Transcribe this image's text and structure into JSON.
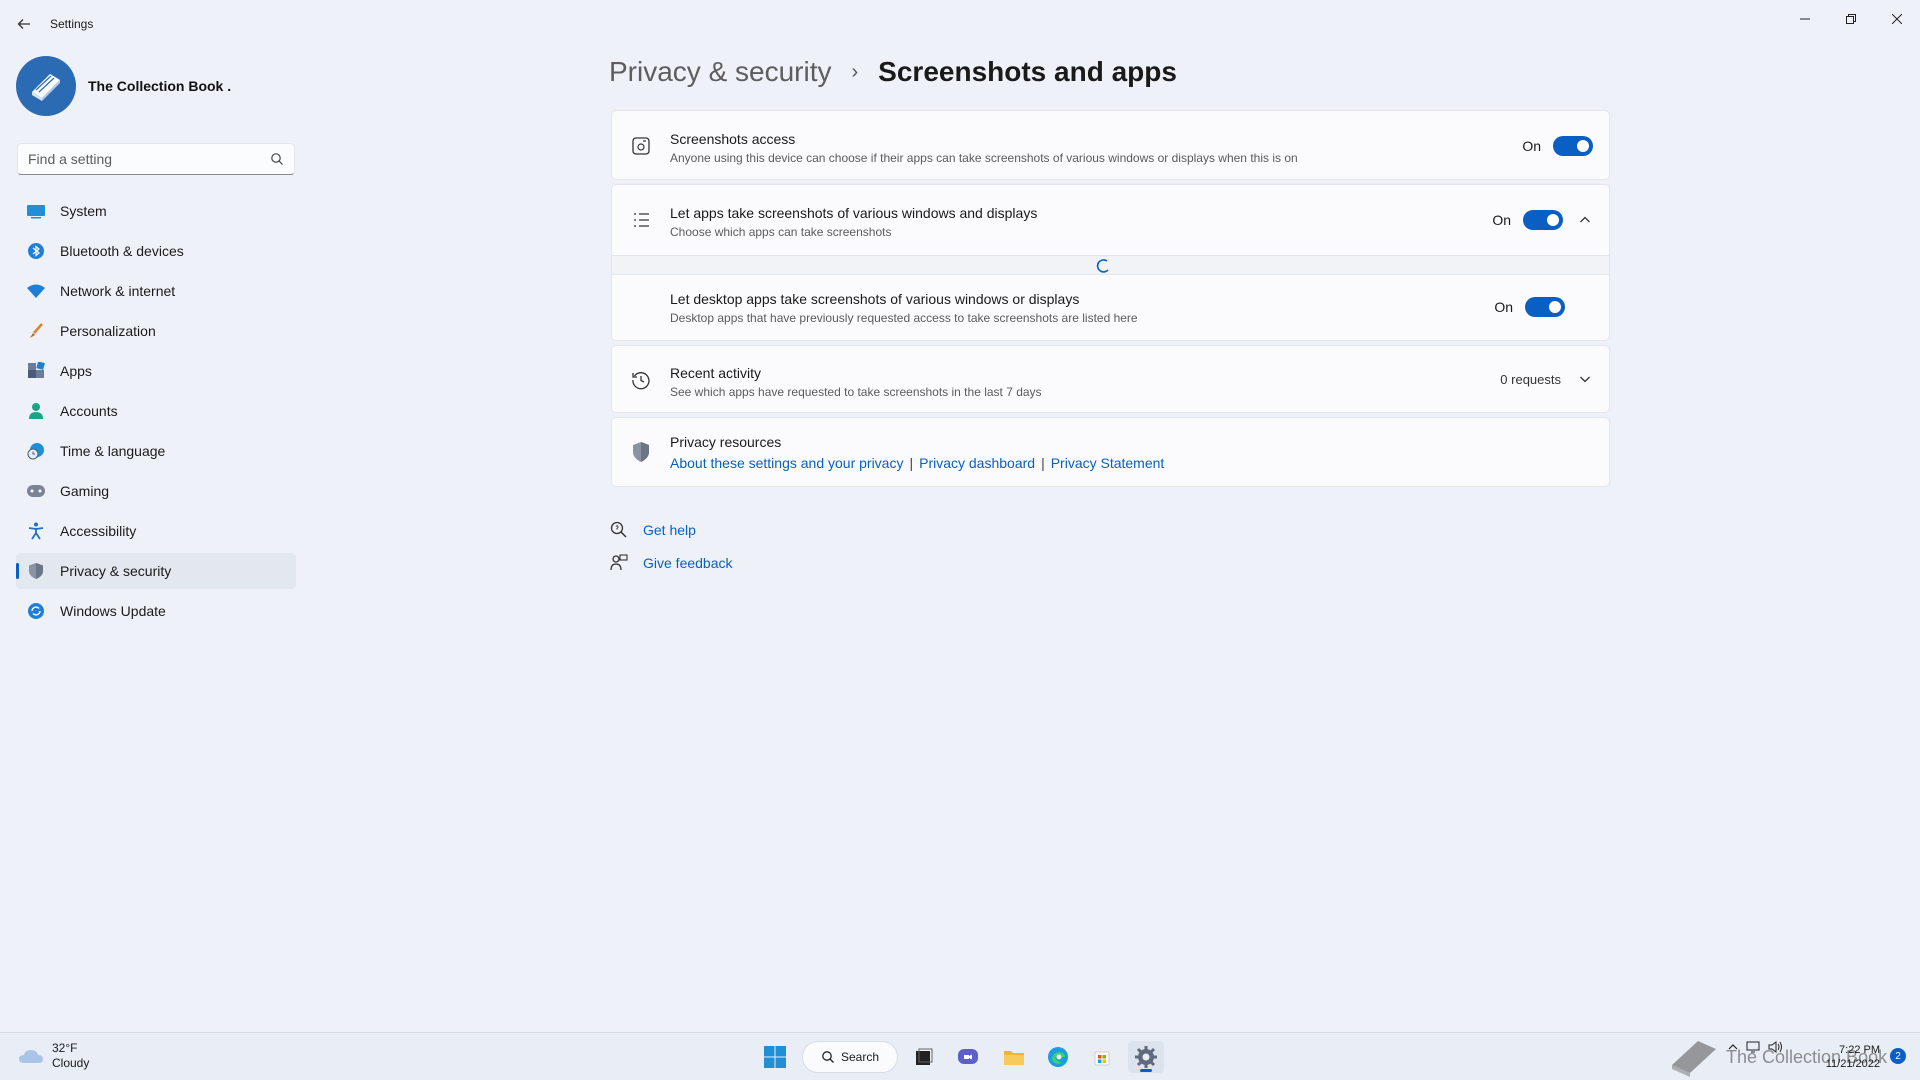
{
  "window": {
    "app_title": "Settings",
    "controls": {
      "minimize": "—",
      "restore": "❐",
      "close": "✕"
    }
  },
  "profile": {
    "name": "The Collection Book ."
  },
  "search": {
    "placeholder": "Find a setting"
  },
  "sidebar": {
    "items": [
      {
        "label": "System",
        "icon": "system-icon"
      },
      {
        "label": "Bluetooth & devices",
        "icon": "bluetooth-icon"
      },
      {
        "label": "Network & internet",
        "icon": "wifi-icon"
      },
      {
        "label": "Personalization",
        "icon": "brush-icon"
      },
      {
        "label": "Apps",
        "icon": "apps-icon"
      },
      {
        "label": "Accounts",
        "icon": "account-icon"
      },
      {
        "label": "Time & language",
        "icon": "clock-globe-icon"
      },
      {
        "label": "Gaming",
        "icon": "gamepad-icon"
      },
      {
        "label": "Accessibility",
        "icon": "accessibility-icon"
      },
      {
        "label": "Privacy & security",
        "icon": "shield-icon",
        "active": true
      },
      {
        "label": "Windows Update",
        "icon": "update-icon"
      }
    ]
  },
  "breadcrumb": {
    "parent": "Privacy & security",
    "separator": "›",
    "current": "Screenshots and apps"
  },
  "settings": {
    "screenshots_access": {
      "title": "Screenshots access",
      "desc": "Anyone using this device can choose if their apps can take screenshots of various windows or displays when this is on",
      "state": "On"
    },
    "let_apps": {
      "title": "Let apps take screenshots of various windows and displays",
      "desc": "Choose which apps can take screenshots",
      "state": "On"
    },
    "desktop_apps": {
      "title": "Let desktop apps take screenshots of various windows or displays",
      "desc": "Desktop apps that have previously requested access to take screenshots are listed here",
      "state": "On"
    },
    "recent_activity": {
      "title": "Recent activity",
      "desc": "See which apps have requested to take screenshots in the last 7 days",
      "value": "0 requests"
    },
    "privacy_resources": {
      "title": "Privacy resources",
      "links": [
        "About these settings and your privacy",
        "Privacy dashboard",
        "Privacy Statement"
      ],
      "separator": "|"
    }
  },
  "help": {
    "get_help": "Get help",
    "give_feedback": "Give feedback"
  },
  "taskbar": {
    "weather": {
      "temp": "32°F",
      "condition": "Cloudy"
    },
    "search_label": "Search",
    "clock": {
      "time": "7:22 PM",
      "date": "11/21/2022"
    },
    "notification_count": "2",
    "watermark": "The Collection Book"
  },
  "colors": {
    "accent": "#0a5fc4",
    "background": "#eef2f8",
    "card": "#fbfbfd"
  }
}
